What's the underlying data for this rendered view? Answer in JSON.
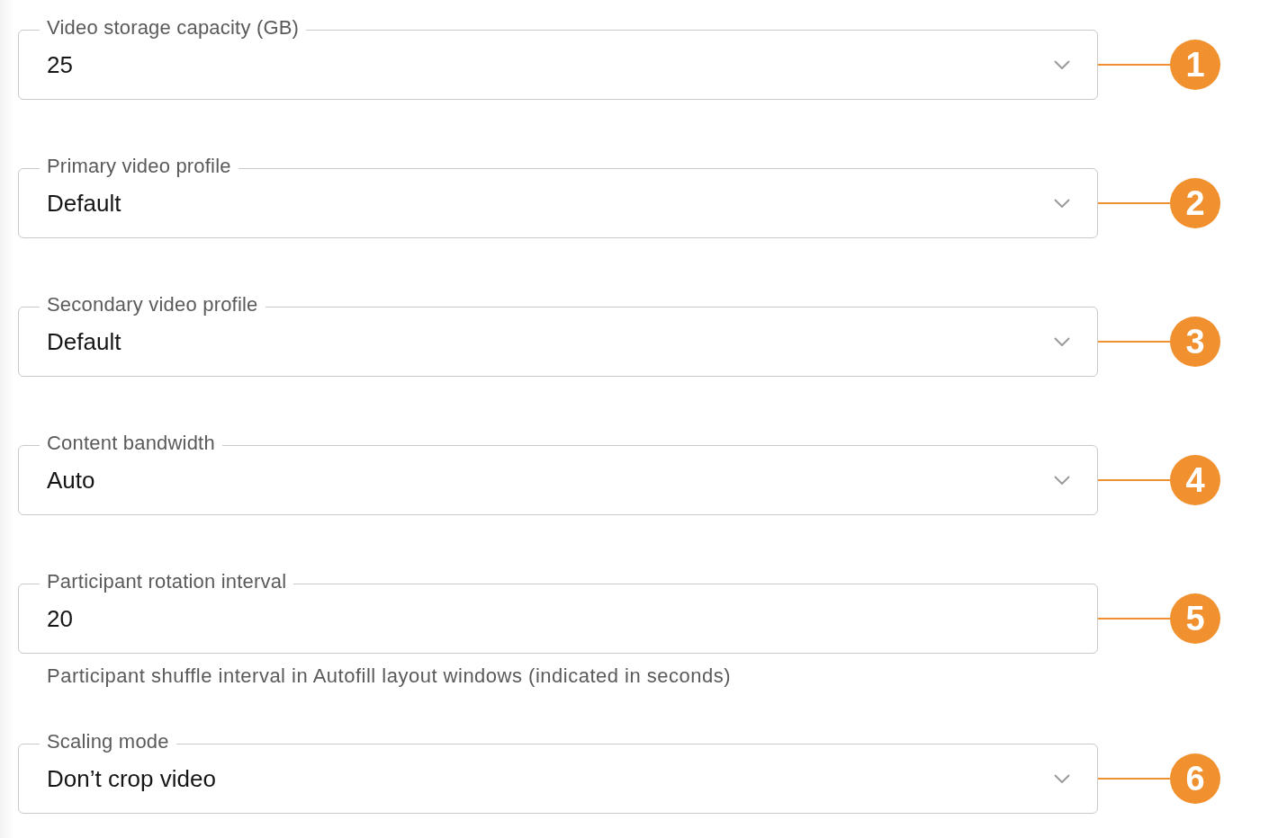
{
  "fields": [
    {
      "kind": "select",
      "label": "Video storage capacity (GB)",
      "value": "25",
      "callout": "1"
    },
    {
      "kind": "select",
      "label": "Primary video profile",
      "value": "Default",
      "callout": "2"
    },
    {
      "kind": "select",
      "label": "Secondary video profile",
      "value": "Default",
      "callout": "3"
    },
    {
      "kind": "select",
      "label": "Content bandwidth",
      "value": "Auto",
      "callout": "4"
    },
    {
      "kind": "text",
      "label": "Participant rotation interval",
      "value": "20",
      "helper": "Participant shuffle interval in Autofill layout windows (indicated in seconds)",
      "callout": "5"
    },
    {
      "kind": "select",
      "label": "Scaling mode",
      "value": "Don’t crop video",
      "callout": "6"
    }
  ]
}
